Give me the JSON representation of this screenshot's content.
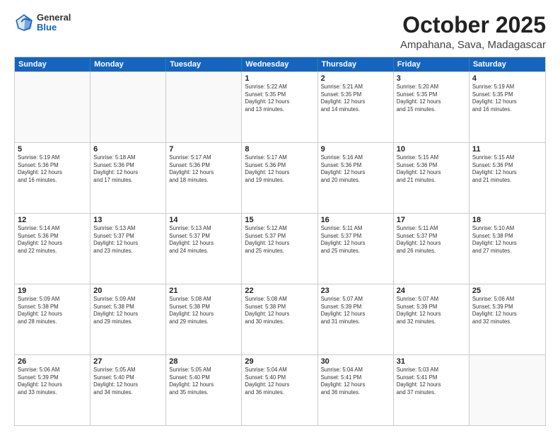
{
  "logo": {
    "general": "General",
    "blue": "Blue"
  },
  "header": {
    "month": "October 2025",
    "location": "Ampahana, Sava, Madagascar"
  },
  "days": [
    "Sunday",
    "Monday",
    "Tuesday",
    "Wednesday",
    "Thursday",
    "Friday",
    "Saturday"
  ],
  "rows": [
    [
      {
        "day": "",
        "lines": []
      },
      {
        "day": "",
        "lines": []
      },
      {
        "day": "",
        "lines": []
      },
      {
        "day": "1",
        "lines": [
          "Sunrise: 5:22 AM",
          "Sunset: 5:35 PM",
          "Daylight: 12 hours",
          "and 13 minutes."
        ]
      },
      {
        "day": "2",
        "lines": [
          "Sunrise: 5:21 AM",
          "Sunset: 5:35 PM",
          "Daylight: 12 hours",
          "and 14 minutes."
        ]
      },
      {
        "day": "3",
        "lines": [
          "Sunrise: 5:20 AM",
          "Sunset: 5:35 PM",
          "Daylight: 12 hours",
          "and 15 minutes."
        ]
      },
      {
        "day": "4",
        "lines": [
          "Sunrise: 5:19 AM",
          "Sunset: 5:35 PM",
          "Daylight: 12 hours",
          "and 16 minutes."
        ]
      }
    ],
    [
      {
        "day": "5",
        "lines": [
          "Sunrise: 5:19 AM",
          "Sunset: 5:36 PM",
          "Daylight: 12 hours",
          "and 16 minutes."
        ]
      },
      {
        "day": "6",
        "lines": [
          "Sunrise: 5:18 AM",
          "Sunset: 5:36 PM",
          "Daylight: 12 hours",
          "and 17 minutes."
        ]
      },
      {
        "day": "7",
        "lines": [
          "Sunrise: 5:17 AM",
          "Sunset: 5:36 PM",
          "Daylight: 12 hours",
          "and 18 minutes."
        ]
      },
      {
        "day": "8",
        "lines": [
          "Sunrise: 5:17 AM",
          "Sunset: 5:36 PM",
          "Daylight: 12 hours",
          "and 19 minutes."
        ]
      },
      {
        "day": "9",
        "lines": [
          "Sunrise: 5:16 AM",
          "Sunset: 5:36 PM",
          "Daylight: 12 hours",
          "and 20 minutes."
        ]
      },
      {
        "day": "10",
        "lines": [
          "Sunrise: 5:15 AM",
          "Sunset: 5:36 PM",
          "Daylight: 12 hours",
          "and 21 minutes."
        ]
      },
      {
        "day": "11",
        "lines": [
          "Sunrise: 5:15 AM",
          "Sunset: 5:36 PM",
          "Daylight: 12 hours",
          "and 21 minutes."
        ]
      }
    ],
    [
      {
        "day": "12",
        "lines": [
          "Sunrise: 5:14 AM",
          "Sunset: 5:36 PM",
          "Daylight: 12 hours",
          "and 22 minutes."
        ]
      },
      {
        "day": "13",
        "lines": [
          "Sunrise: 5:13 AM",
          "Sunset: 5:37 PM",
          "Daylight: 12 hours",
          "and 23 minutes."
        ]
      },
      {
        "day": "14",
        "lines": [
          "Sunrise: 5:13 AM",
          "Sunset: 5:37 PM",
          "Daylight: 12 hours",
          "and 24 minutes."
        ]
      },
      {
        "day": "15",
        "lines": [
          "Sunrise: 5:12 AM",
          "Sunset: 5:37 PM",
          "Daylight: 12 hours",
          "and 25 minutes."
        ]
      },
      {
        "day": "16",
        "lines": [
          "Sunrise: 5:11 AM",
          "Sunset: 5:37 PM",
          "Daylight: 12 hours",
          "and 25 minutes."
        ]
      },
      {
        "day": "17",
        "lines": [
          "Sunrise: 5:11 AM",
          "Sunset: 5:37 PM",
          "Daylight: 12 hours",
          "and 26 minutes."
        ]
      },
      {
        "day": "18",
        "lines": [
          "Sunrise: 5:10 AM",
          "Sunset: 5:38 PM",
          "Daylight: 12 hours",
          "and 27 minutes."
        ]
      }
    ],
    [
      {
        "day": "19",
        "lines": [
          "Sunrise: 5:09 AM",
          "Sunset: 5:38 PM",
          "Daylight: 12 hours",
          "and 28 minutes."
        ]
      },
      {
        "day": "20",
        "lines": [
          "Sunrise: 5:09 AM",
          "Sunset: 5:38 PM",
          "Daylight: 12 hours",
          "and 29 minutes."
        ]
      },
      {
        "day": "21",
        "lines": [
          "Sunrise: 5:08 AM",
          "Sunset: 5:38 PM",
          "Daylight: 12 hours",
          "and 29 minutes."
        ]
      },
      {
        "day": "22",
        "lines": [
          "Sunrise: 5:08 AM",
          "Sunset: 5:38 PM",
          "Daylight: 12 hours",
          "and 30 minutes."
        ]
      },
      {
        "day": "23",
        "lines": [
          "Sunrise: 5:07 AM",
          "Sunset: 5:39 PM",
          "Daylight: 12 hours",
          "and 31 minutes."
        ]
      },
      {
        "day": "24",
        "lines": [
          "Sunrise: 5:07 AM",
          "Sunset: 5:39 PM",
          "Daylight: 12 hours",
          "and 32 minutes."
        ]
      },
      {
        "day": "25",
        "lines": [
          "Sunrise: 5:06 AM",
          "Sunset: 5:39 PM",
          "Daylight: 12 hours",
          "and 32 minutes."
        ]
      }
    ],
    [
      {
        "day": "26",
        "lines": [
          "Sunrise: 5:06 AM",
          "Sunset: 5:39 PM",
          "Daylight: 12 hours",
          "and 33 minutes."
        ]
      },
      {
        "day": "27",
        "lines": [
          "Sunrise: 5:05 AM",
          "Sunset: 5:40 PM",
          "Daylight: 12 hours",
          "and 34 minutes."
        ]
      },
      {
        "day": "28",
        "lines": [
          "Sunrise: 5:05 AM",
          "Sunset: 5:40 PM",
          "Daylight: 12 hours",
          "and 35 minutes."
        ]
      },
      {
        "day": "29",
        "lines": [
          "Sunrise: 5:04 AM",
          "Sunset: 5:40 PM",
          "Daylight: 12 hours",
          "and 36 minutes."
        ]
      },
      {
        "day": "30",
        "lines": [
          "Sunrise: 5:04 AM",
          "Sunset: 5:41 PM",
          "Daylight: 12 hours",
          "and 36 minutes."
        ]
      },
      {
        "day": "31",
        "lines": [
          "Sunrise: 5:03 AM",
          "Sunset: 5:41 PM",
          "Daylight: 12 hours",
          "and 37 minutes."
        ]
      },
      {
        "day": "",
        "lines": []
      }
    ]
  ]
}
